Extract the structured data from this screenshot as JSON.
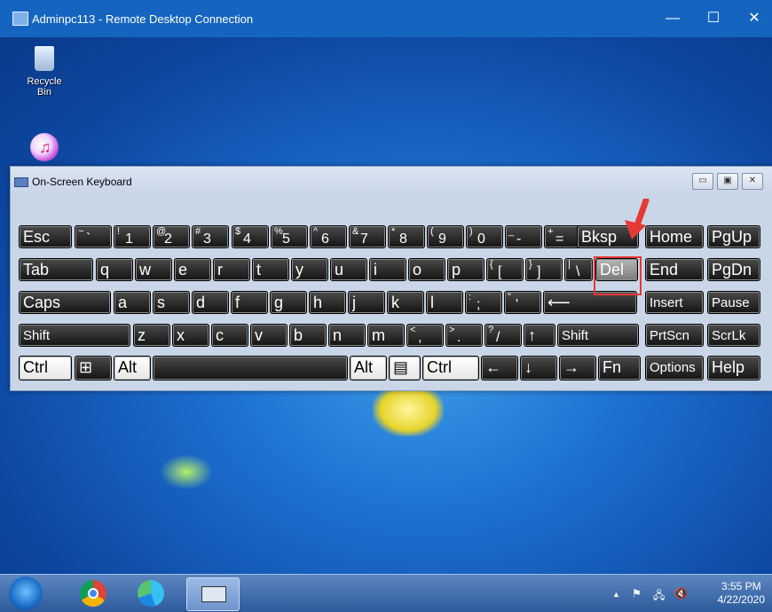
{
  "window": {
    "title": "Adminpc113 - Remote Desktop Connection",
    "minimize": "—",
    "maximize": "☐",
    "close": "✕"
  },
  "desktop": {
    "recycle_bin": "Recycle Bin"
  },
  "osk": {
    "title": "On-Screen Keyboard",
    "title_buttons": [
      "▭",
      "▣",
      "✕"
    ],
    "rows": [
      [
        {
          "id": "esc",
          "label": "Esc"
        },
        {
          "id": "tilde",
          "shift": "~",
          "base": "`"
        },
        {
          "id": "1",
          "shift": "!",
          "base": "1"
        },
        {
          "id": "2",
          "shift": "@",
          "base": "2"
        },
        {
          "id": "3",
          "shift": "#",
          "base": "3"
        },
        {
          "id": "4",
          "shift": "$",
          "base": "4"
        },
        {
          "id": "5",
          "shift": "%",
          "base": "5"
        },
        {
          "id": "6",
          "shift": "^",
          "base": "6"
        },
        {
          "id": "7",
          "shift": "&",
          "base": "7"
        },
        {
          "id": "8",
          "shift": "*",
          "base": "8"
        },
        {
          "id": "9",
          "shift": "(",
          "base": "9"
        },
        {
          "id": "0",
          "shift": ")",
          "base": "0"
        },
        {
          "id": "minus",
          "shift": "_",
          "base": "-"
        },
        {
          "id": "equals",
          "shift": "+",
          "base": "="
        },
        {
          "id": "bksp",
          "label": "Bksp"
        },
        {
          "id": "home",
          "label": "Home"
        },
        {
          "id": "pgup",
          "label": "PgUp"
        }
      ],
      [
        {
          "id": "tab",
          "label": "Tab"
        },
        {
          "id": "q",
          "label": "q"
        },
        {
          "id": "w",
          "label": "w"
        },
        {
          "id": "e",
          "label": "e"
        },
        {
          "id": "r",
          "label": "r"
        },
        {
          "id": "t",
          "label": "t"
        },
        {
          "id": "y",
          "label": "y"
        },
        {
          "id": "u",
          "label": "u"
        },
        {
          "id": "i",
          "label": "i"
        },
        {
          "id": "o",
          "label": "o"
        },
        {
          "id": "p",
          "label": "p"
        },
        {
          "id": "lbracket",
          "shift": "{",
          "base": "["
        },
        {
          "id": "rbracket",
          "shift": "}",
          "base": "]"
        },
        {
          "id": "backslash",
          "shift": "|",
          "base": "\\"
        },
        {
          "id": "del",
          "label": "Del"
        },
        {
          "id": "end",
          "label": "End"
        },
        {
          "id": "pgdn",
          "label": "PgDn"
        }
      ],
      [
        {
          "id": "caps",
          "label": "Caps"
        },
        {
          "id": "a",
          "label": "a"
        },
        {
          "id": "s",
          "label": "s"
        },
        {
          "id": "d",
          "label": "d"
        },
        {
          "id": "f",
          "label": "f"
        },
        {
          "id": "g",
          "label": "g"
        },
        {
          "id": "h",
          "label": "h"
        },
        {
          "id": "j",
          "label": "j"
        },
        {
          "id": "k",
          "label": "k"
        },
        {
          "id": "l",
          "label": "l"
        },
        {
          "id": "semicolon",
          "shift": ":",
          "base": ";"
        },
        {
          "id": "quote",
          "shift": "\"",
          "base": "'"
        },
        {
          "id": "enter",
          "label": "⟵"
        },
        {
          "id": "insert",
          "label": "Insert"
        },
        {
          "id": "pause",
          "label": "Pause"
        }
      ],
      [
        {
          "id": "lshift",
          "label": "Shift"
        },
        {
          "id": "z",
          "label": "z"
        },
        {
          "id": "x",
          "label": "x"
        },
        {
          "id": "c",
          "label": "c"
        },
        {
          "id": "v",
          "label": "v"
        },
        {
          "id": "b",
          "label": "b"
        },
        {
          "id": "n",
          "label": "n"
        },
        {
          "id": "m",
          "label": "m"
        },
        {
          "id": "comma",
          "shift": "<",
          "base": ","
        },
        {
          "id": "period",
          "shift": ">",
          "base": "."
        },
        {
          "id": "slash",
          "shift": "?",
          "base": "/"
        },
        {
          "id": "up",
          "label": "↑"
        },
        {
          "id": "rshift",
          "label": "Shift"
        },
        {
          "id": "prtscn",
          "label": "PrtScn"
        },
        {
          "id": "scrlk",
          "label": "ScrLk"
        }
      ],
      [
        {
          "id": "lctrl",
          "label": "Ctrl"
        },
        {
          "id": "win",
          "label": "⊞"
        },
        {
          "id": "lalt",
          "label": "Alt"
        },
        {
          "id": "space",
          "label": ""
        },
        {
          "id": "ralt",
          "label": "Alt"
        },
        {
          "id": "menu",
          "label": "▤"
        },
        {
          "id": "rctrl",
          "label": "Ctrl"
        },
        {
          "id": "left",
          "label": "←"
        },
        {
          "id": "down",
          "label": "↓"
        },
        {
          "id": "right",
          "label": "→"
        },
        {
          "id": "fn",
          "label": "Fn"
        },
        {
          "id": "options",
          "label": "Options"
        },
        {
          "id": "help",
          "label": "Help"
        }
      ]
    ]
  },
  "taskbar": {
    "time": "3:55 PM",
    "date": "4/22/2020",
    "tray_icons": [
      "▲",
      "⚑",
      "🖧",
      "🔇"
    ]
  },
  "colors": {
    "highlight": "#e53935",
    "desktop": "#1d6fd0"
  }
}
